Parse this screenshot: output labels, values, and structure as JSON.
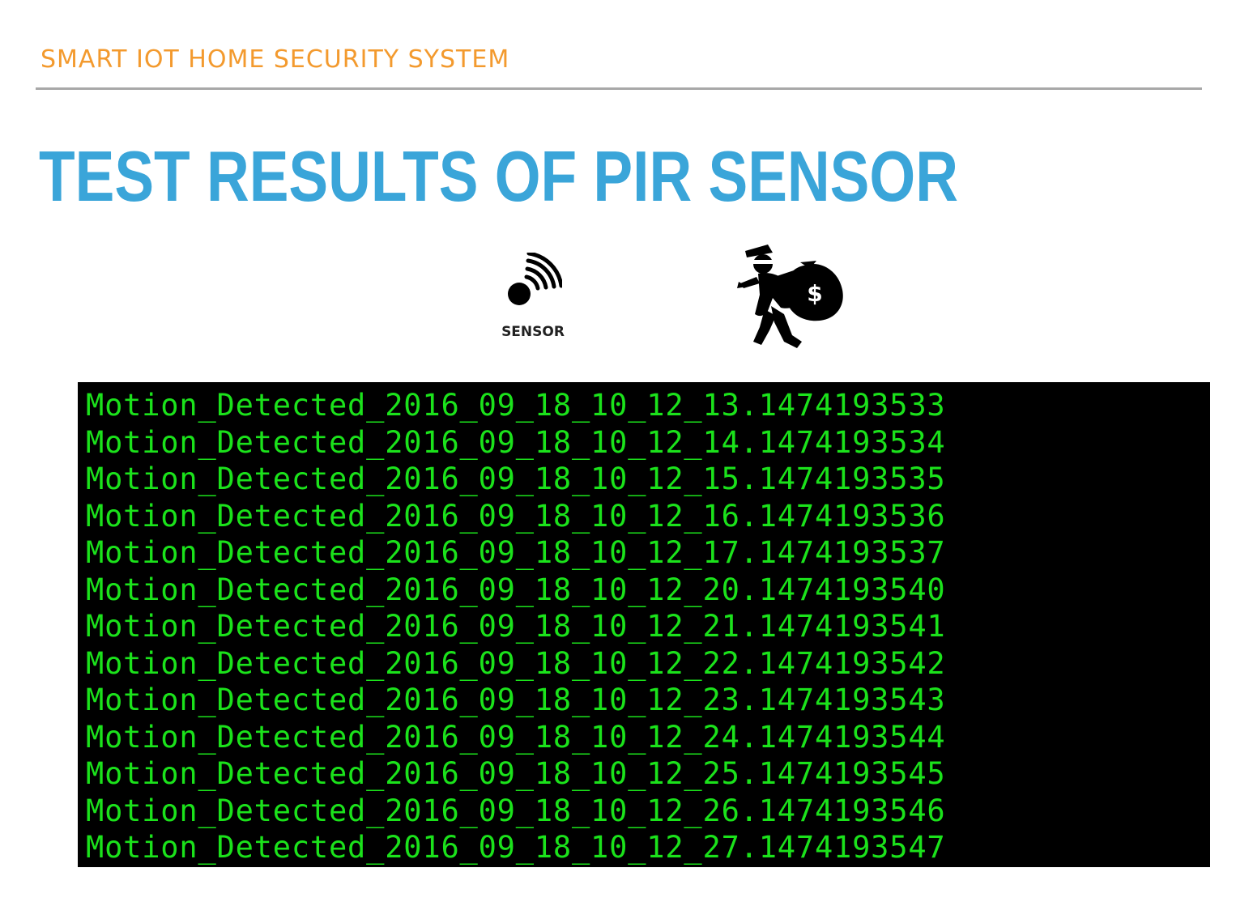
{
  "header": {
    "label": "SMART IOT HOME SECURITY SYSTEM"
  },
  "title": "TEST RESULTS OF PIR SENSOR",
  "sensor": {
    "caption": "SENSOR",
    "icon": "wireless-sensor-icon"
  },
  "thief": {
    "icon": "thief-with-money-bag-icon"
  },
  "colors": {
    "header_orange": "#f39a2e",
    "title_blue": "#3aa5d9",
    "terminal_bg": "#000000",
    "terminal_text": "#1be21b"
  },
  "log": {
    "lines": [
      "Motion_Detected_2016_09_18_10_12_13.1474193533",
      "Motion_Detected_2016_09_18_10_12_14.1474193534",
      "Motion_Detected_2016_09_18_10_12_15.1474193535",
      "Motion_Detected_2016_09_18_10_12_16.1474193536",
      "Motion_Detected_2016_09_18_10_12_17.1474193537",
      "Motion_Detected_2016_09_18_10_12_20.1474193540",
      "Motion_Detected_2016_09_18_10_12_21.1474193541",
      "Motion_Detected_2016_09_18_10_12_22.1474193542",
      "Motion_Detected_2016_09_18_10_12_23.1474193543",
      "Motion_Detected_2016_09_18_10_12_24.1474193544",
      "Motion_Detected_2016_09_18_10_12_25.1474193545",
      "Motion_Detected_2016_09_18_10_12_26.1474193546",
      "Motion_Detected_2016_09_18_10_12_27.1474193547"
    ]
  }
}
